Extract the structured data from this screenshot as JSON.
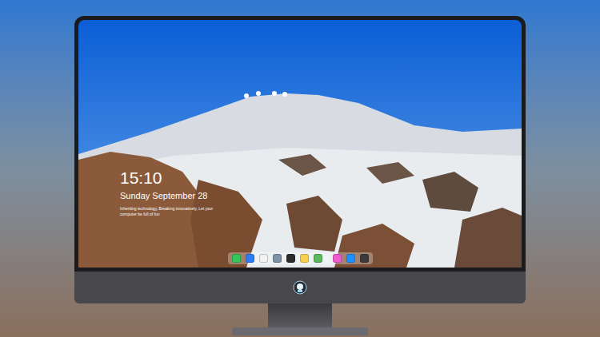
{
  "lock_screen": {
    "time": "15:10",
    "date": "Sunday September 28",
    "tagline": "Inheriting technology, Breaking innovatively, Let your computer be full of fun"
  },
  "dock": {
    "apps": [
      {
        "color": "#34c759"
      },
      {
        "color": "#2f7cf6"
      },
      {
        "color": "#f2f2f2"
      },
      {
        "color": "#7f93a8"
      },
      {
        "color": "#2b2b2b"
      },
      {
        "color": "#f7d250"
      },
      {
        "color": "#5cb85c"
      },
      {
        "color": "#f05bd0"
      },
      {
        "color": "#1e90ff"
      },
      {
        "color": "#3a3a3c"
      }
    ]
  }
}
